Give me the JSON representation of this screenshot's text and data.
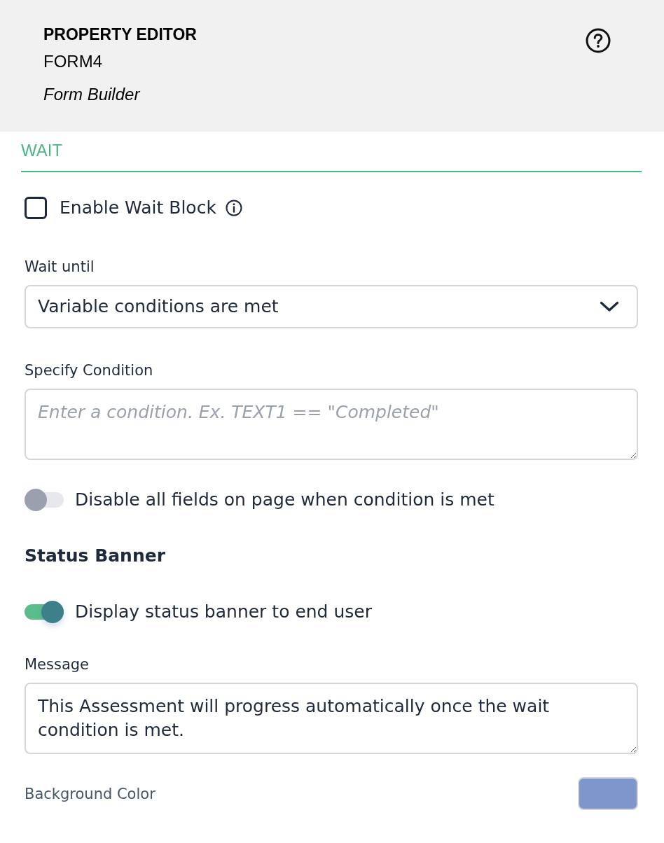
{
  "header": {
    "title": "PROPERTY EDITOR",
    "form_name": "FORM4",
    "subtitle": "Form Builder"
  },
  "tabs": [
    {
      "label": "WAIT",
      "selected": true
    }
  ],
  "enable_wait_block": {
    "label": "Enable Wait Block",
    "checked": false
  },
  "wait_until": {
    "label": "Wait until",
    "value": "Variable conditions are met"
  },
  "condition": {
    "label": "Specify Condition",
    "placeholder": "Enter a condition. Ex. TEXT1 == \"Completed\""
  },
  "disable_fields": {
    "label": "Disable all fields on page when condition is met",
    "on": false
  },
  "status_banner": {
    "heading": "Status Banner",
    "display": {
      "label": "Display status banner to end user",
      "on": true
    },
    "message": {
      "label": "Message",
      "value": "This Assessment will progress automatically once the wait condition is met."
    },
    "background_color": {
      "label": "Background Color",
      "color": "#7f96cc"
    }
  }
}
